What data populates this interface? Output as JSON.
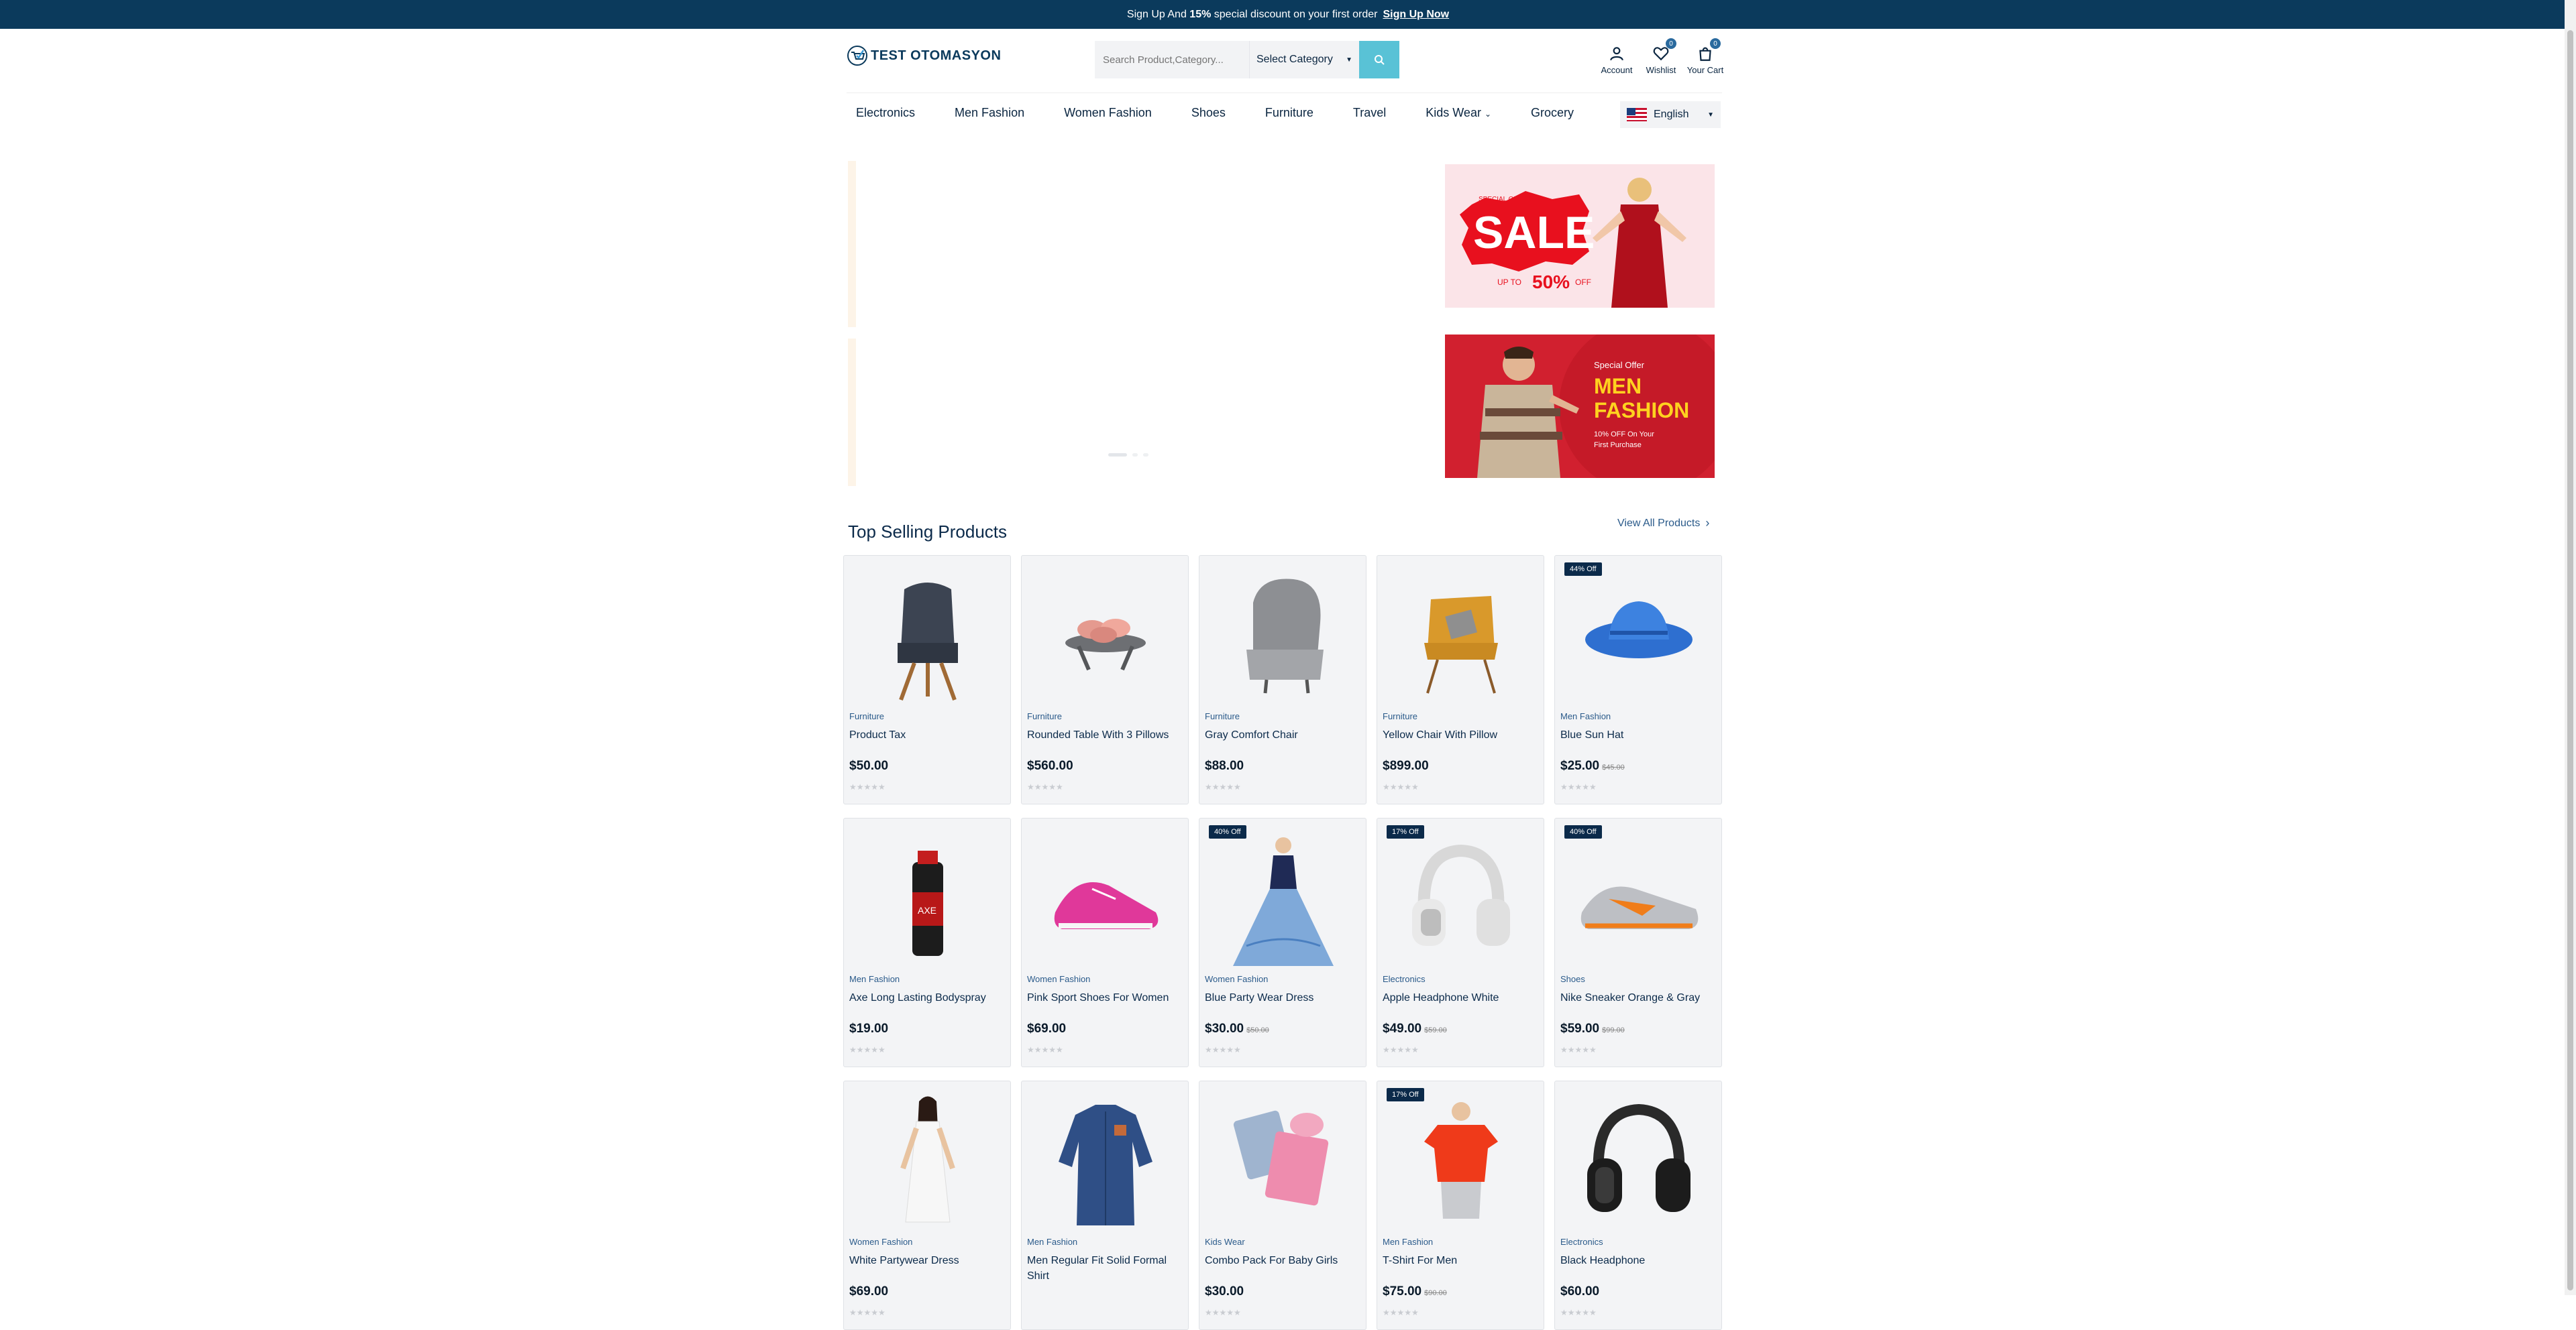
{
  "announcement": {
    "prefix": "Sign Up And",
    "percent": "15%",
    "suffix": "special discount on your first order",
    "link": "Sign Up Now"
  },
  "header": {
    "logo_text": "TEST OTOMASYON",
    "search_placeholder": "Search Product,Category...",
    "category_select": "Select Category",
    "account_label": "Account",
    "wishlist_label": "Wishlist",
    "wishlist_count": "0",
    "cart_label": "Your Cart",
    "cart_count": "0"
  },
  "nav": {
    "items": [
      "Electronics",
      "Men Fashion",
      "Women Fashion",
      "Shoes",
      "Furniture",
      "Travel",
      "Kids Wear",
      "Grocery"
    ],
    "language": "English"
  },
  "banners": {
    "sale": {
      "small": "SPECIAL OFFER",
      "big": "SALE",
      "upto": "UP TO",
      "pct": "50%",
      "off": "OFF"
    },
    "men": {
      "small": "Special Offer",
      "line1": "MEN",
      "line2": "FASHION",
      "sub1": "10% OFF On Your",
      "sub2": "First Purchase"
    }
  },
  "section": {
    "title": "Top Selling Products",
    "view_all": "View All Products"
  },
  "products": [
    {
      "cat": "Furniture",
      "name": "Product Tax",
      "price": "$50.00",
      "old": "",
      "off": "",
      "img": "dark-chair"
    },
    {
      "cat": "Furniture",
      "name": "Rounded Table With 3 Pillows",
      "price": "$560.00",
      "old": "",
      "off": "",
      "img": "table-pillows"
    },
    {
      "cat": "Furniture",
      "name": "Gray Comfort Chair",
      "price": "$88.00",
      "old": "",
      "off": "",
      "img": "gray-chair"
    },
    {
      "cat": "Furniture",
      "name": "Yellow Chair With Pillow",
      "price": "$899.00",
      "old": "",
      "off": "",
      "img": "yellow-chair"
    },
    {
      "cat": "Men Fashion",
      "name": "Blue Sun Hat",
      "price": "$25.00",
      "old": "$45.00",
      "off": "44% Off",
      "img": "blue-hat"
    },
    {
      "cat": "Men Fashion",
      "name": "Axe Long Lasting Bodyspray",
      "price": "$19.00",
      "old": "",
      "off": "",
      "img": "bodyspray"
    },
    {
      "cat": "Women Fashion",
      "name": "Pink Sport Shoes For Women",
      "price": "$69.00",
      "old": "",
      "off": "",
      "img": "pink-shoe"
    },
    {
      "cat": "Women Fashion",
      "name": "Blue Party Wear Dress",
      "price": "$30.00",
      "old": "$50.00",
      "off": "40% Off",
      "img": "blue-dress"
    },
    {
      "cat": "Electronics",
      "name": "Apple Headphone White",
      "price": "$49.00",
      "old": "$59.00",
      "off": "17% Off",
      "img": "white-headphone"
    },
    {
      "cat": "Shoes",
      "name": "Nike Sneaker Orange & Gray",
      "price": "$59.00",
      "old": "$99.00",
      "off": "40% Off",
      "img": "sneaker"
    },
    {
      "cat": "Women Fashion",
      "name": "White Partywear Dress",
      "price": "$69.00",
      "old": "",
      "off": "",
      "img": "white-dress"
    },
    {
      "cat": "Men Fashion",
      "name": "Men Regular Fit Solid Formal Shirt",
      "price": "",
      "old": "",
      "off": "",
      "img": "shirt"
    },
    {
      "cat": "Kids Wear",
      "name": "Combo Pack For Baby Girls",
      "price": "$30.00",
      "old": "",
      "off": "",
      "img": "baby-combo"
    },
    {
      "cat": "Men Fashion",
      "name": "T-Shirt For Men",
      "price": "$75.00",
      "old": "$90.00",
      "off": "17% Off",
      "img": "tshirt"
    },
    {
      "cat": "Electronics",
      "name": "Black Headphone",
      "price": "$60.00",
      "old": "",
      "off": "",
      "img": "black-headphone"
    }
  ],
  "stars": "★★★★★"
}
